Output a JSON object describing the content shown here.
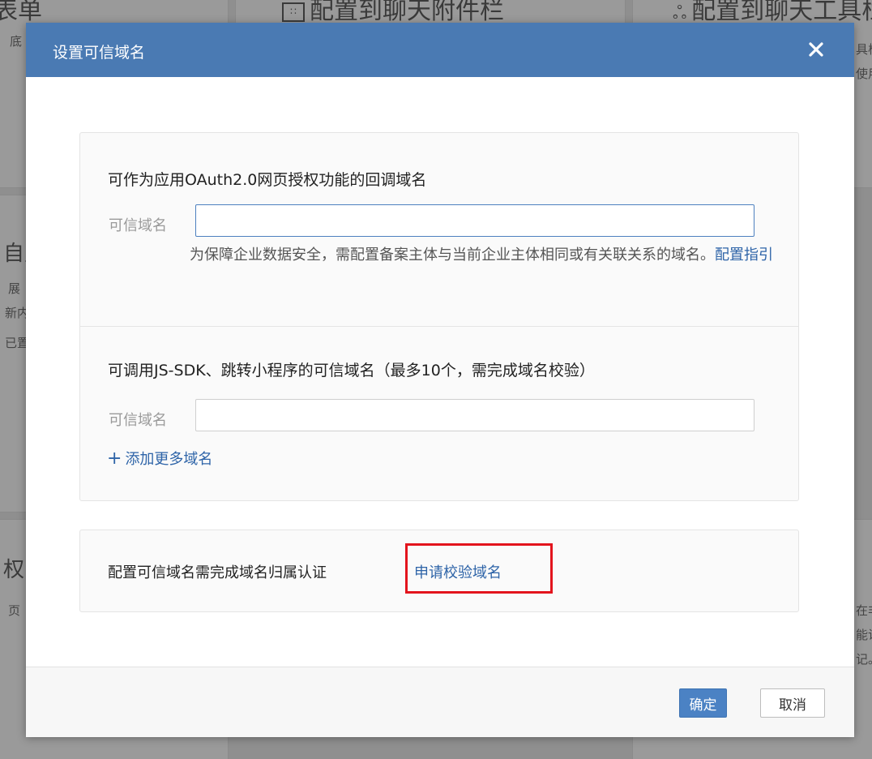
{
  "background": {
    "top_left_title": "表单",
    "top_left_sub": "底",
    "top_mid_title": "配置到聊天附件栏",
    "top_mid_icon": "grid-icon",
    "top_right_title": "配置到聊天工具栏",
    "top_right_icon": "cluster-icon",
    "right_sub_1": "具栏",
    "right_sub_2": "使用",
    "left_mid_title": "自定",
    "left_mid_line1": "展",
    "left_mid_line2": "新内",
    "left_mid_line3": "已置",
    "left_low_title": "权",
    "left_low_line1": "页",
    "right_low_line1": "在非",
    "right_low_line2": "能访",
    "right_low_line3": "记。"
  },
  "modal": {
    "title": "设置可信域名",
    "close_icon": "close-icon",
    "oauth_section": {
      "heading": "可作为应用OAuth2.0网页授权功能的回调域名",
      "field_label": "可信域名",
      "input_value": "",
      "hint": "为保障企业数据安全，需配置备案主体与当前企业主体相同或有关联关系的域名。",
      "guide_link": "配置指引"
    },
    "jssdk_section": {
      "heading": "可调用JS-SDK、跳转小程序的可信域名（最多10个，需完成域名校验）",
      "field_label": "可信域名",
      "input_value": "",
      "add_more_icon": "plus-icon",
      "add_more_label": "添加更多域名"
    },
    "verify_section": {
      "text": "配置可信域名需完成域名归属认证",
      "link": "申请校验域名",
      "highlight_color": "#e3141d"
    },
    "footer": {
      "confirm_label": "确定",
      "cancel_label": "取消"
    }
  },
  "colors": {
    "header": "#4a7ab3",
    "link": "#2e64a8",
    "primary_button": "#4b82c4"
  }
}
